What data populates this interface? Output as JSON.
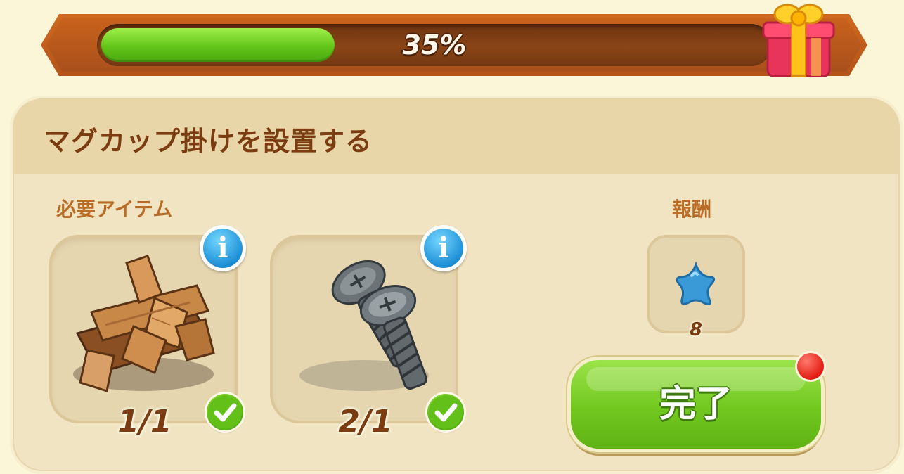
{
  "progress": {
    "percent_label": "35%",
    "value": 0.35,
    "reward_icon": "gift-box-icon"
  },
  "task": {
    "title": "マグカップ掛けを設置する",
    "required_label": "必要アイテム",
    "reward_label": "報酬"
  },
  "items": [
    {
      "name": "firewood",
      "icon": "firewood-icon",
      "count": "1/1",
      "complete": true,
      "info_glyph": "i"
    },
    {
      "name": "screws",
      "icon": "screws-icon",
      "count": "2/1",
      "complete": true,
      "info_glyph": "i"
    }
  ],
  "reward": {
    "icon": "blue-star-icon",
    "count": "8",
    "color": "#3a9ad8"
  },
  "complete_button": {
    "label": "完了",
    "has_notification": true
  },
  "colors": {
    "accent_green": "#72c81f",
    "banner_orange": "#c8621c",
    "title_brown": "#7a3c10",
    "label_orange": "#b86c26"
  }
}
